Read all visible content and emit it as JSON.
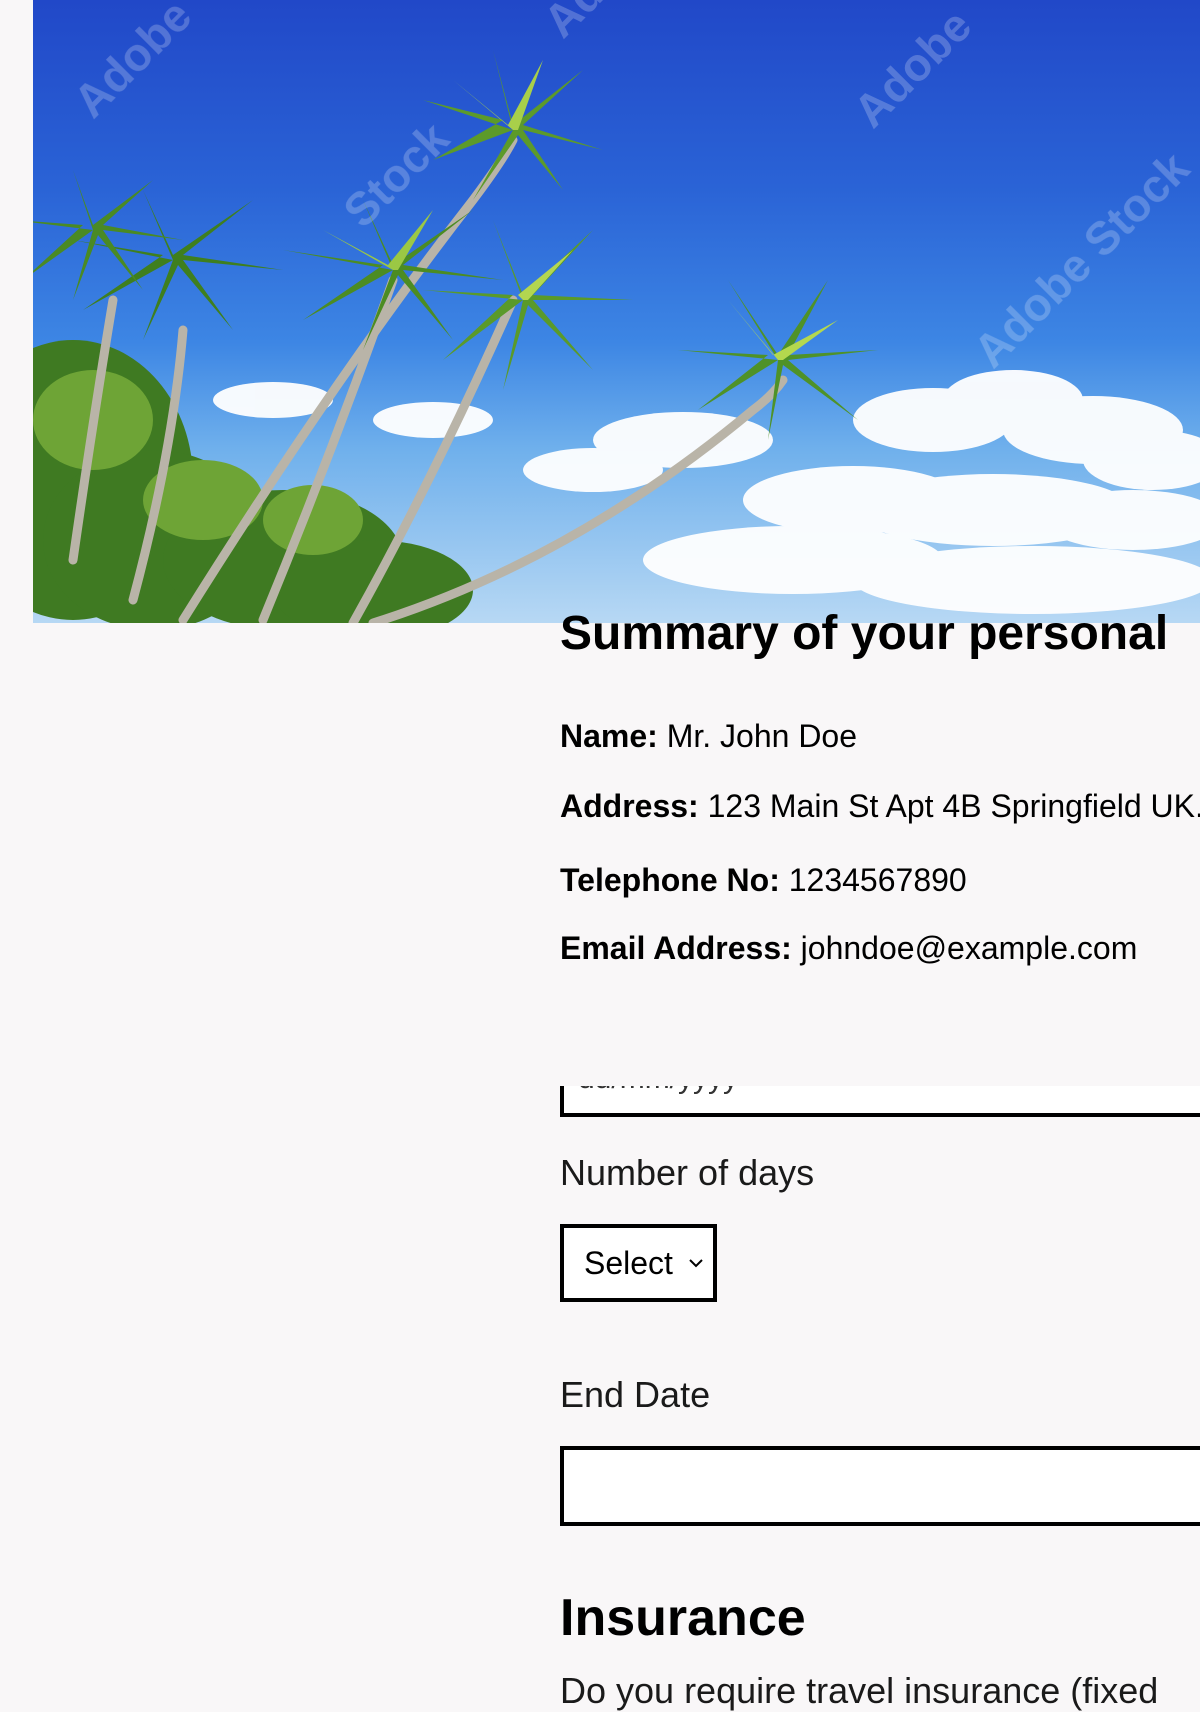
{
  "hero": {
    "watermark": "Adobe Stock"
  },
  "summary": {
    "title": "Summary of your personal",
    "fields": [
      {
        "label": "Name:",
        "value": "Mr. John Doe"
      },
      {
        "label": "Address:",
        "value": "123 Main St Apt 4B Springfield UK."
      },
      {
        "label": "Telephone No:",
        "value": "1234567890"
      },
      {
        "label": "Email Address:",
        "value": "johndoe@example.com"
      }
    ]
  },
  "dates": {
    "start_placeholder": "dd/mm/yyyy",
    "days_label": "Number of days",
    "days_select_value": "Select",
    "end_label": "End Date",
    "end_value": ""
  },
  "insurance": {
    "title": "Insurance",
    "question": "Do you require travel insurance (fixed"
  }
}
